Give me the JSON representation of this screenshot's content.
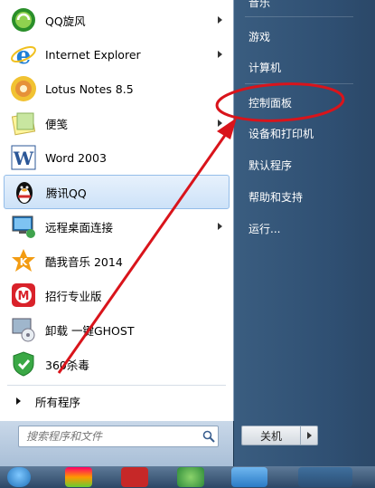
{
  "programs": [
    {
      "label": "QQ旋风",
      "icon": "qq-whirlwind-icon",
      "has_submenu": true
    },
    {
      "label": "Internet Explorer",
      "icon": "internet-explorer-icon",
      "has_submenu": true
    },
    {
      "label": "Lotus Notes 8.5",
      "icon": "lotus-notes-icon",
      "has_submenu": false
    },
    {
      "label": "便笺",
      "icon": "sticky-notes-icon",
      "has_submenu": true
    },
    {
      "label": "Word 2003",
      "icon": "word-icon",
      "has_submenu": false
    },
    {
      "label": "腾讯QQ",
      "icon": "qq-penguin-icon",
      "has_submenu": false
    },
    {
      "label": "远程桌面连接",
      "icon": "remote-desktop-icon",
      "has_submenu": true
    },
    {
      "label": "酷我音乐 2014",
      "icon": "kuwo-music-icon",
      "has_submenu": false
    },
    {
      "label": "招行专业版",
      "icon": "cmb-bank-icon",
      "has_submenu": false
    },
    {
      "label": "卸载 一键GHOST",
      "icon": "uninstall-ghost-icon",
      "has_submenu": false
    },
    {
      "label": "360杀毒",
      "icon": "360-antivirus-icon",
      "has_submenu": false
    }
  ],
  "all_programs_label": "所有程序",
  "search": {
    "placeholder": "搜索程序和文件"
  },
  "right_items": [
    {
      "label": "音乐"
    },
    {
      "label": "游戏"
    },
    {
      "label": "计算机"
    },
    {
      "label": "控制面板"
    },
    {
      "label": "设备和打印机"
    },
    {
      "label": "默认程序"
    },
    {
      "label": "帮助和支持"
    },
    {
      "label": "运行..."
    }
  ],
  "shutdown_label": "关机",
  "colors": {
    "annotation": "#d9141b",
    "right_pane": "#33557a"
  }
}
